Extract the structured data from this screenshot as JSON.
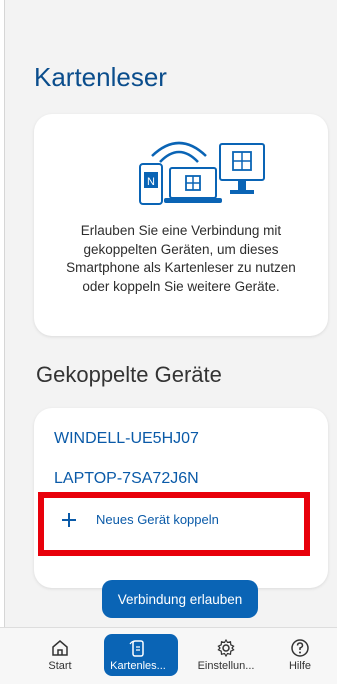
{
  "page": {
    "title": "Kartenleser"
  },
  "info": {
    "text": "Erlauben Sie eine Verbindung mit gekoppelten Geräten, um dieses Smartphone als Kartenleser zu nutzen oder koppeln Sie weitere Geräte."
  },
  "paired_section": {
    "title": "Gekoppelte Geräte"
  },
  "devices": [
    {
      "name": "WINDELL-UE5HJ07"
    },
    {
      "name": "LAPTOP-7SA72J6N"
    }
  ],
  "pair_action": {
    "label": "Neues Gerät koppeln",
    "icon": "plus-icon"
  },
  "allow_button": {
    "label": "Verbindung erlauben"
  },
  "nav": {
    "items": [
      {
        "label": "Start",
        "icon": "home-icon"
      },
      {
        "label": "Kartenles...",
        "icon": "card-reader-icon",
        "active": true
      },
      {
        "label": "Einstellun...",
        "icon": "gear-icon"
      },
      {
        "label": "Hilfe",
        "icon": "help-icon"
      }
    ]
  },
  "colors": {
    "accent": "#0a64b5",
    "title": "#0a4d8c",
    "highlight": "#e8000b"
  }
}
